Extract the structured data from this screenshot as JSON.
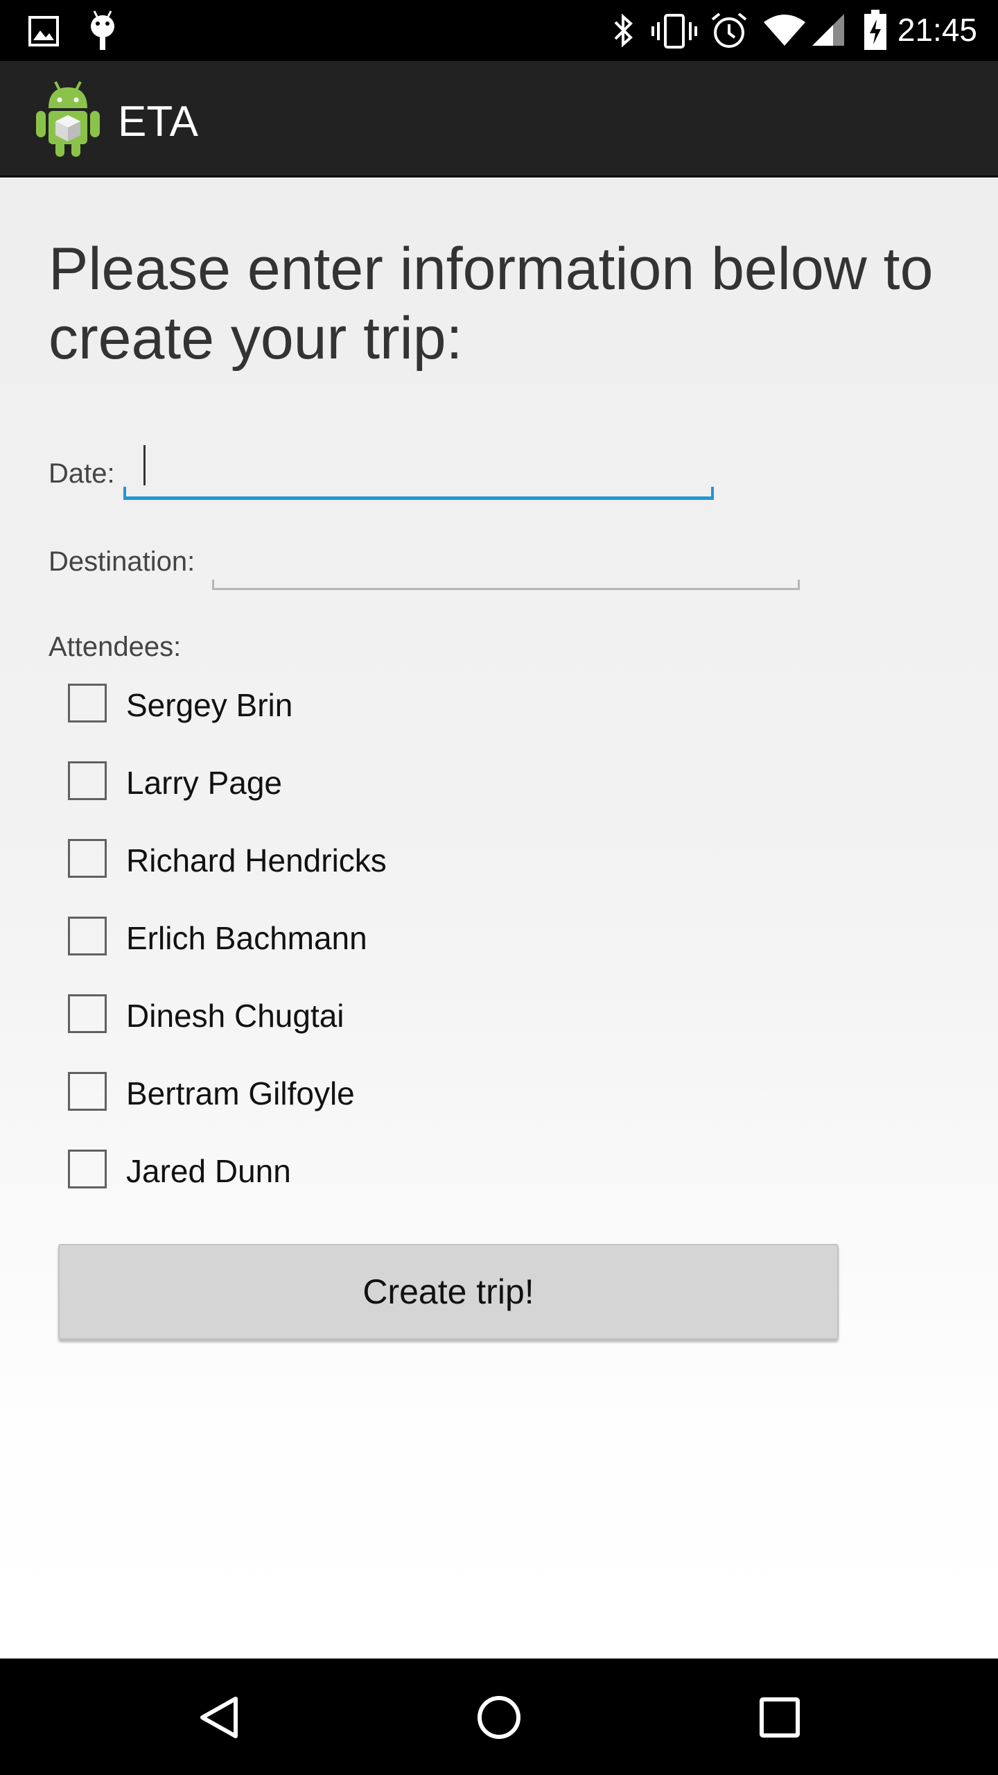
{
  "status_bar": {
    "time": "21:45",
    "left_icons": [
      "image-icon",
      "android-debug-icon"
    ],
    "right_icons": [
      "bluetooth-icon",
      "vibrate-icon",
      "alarm-icon",
      "wifi-icon",
      "cell-signal-icon",
      "battery-charging-icon"
    ]
  },
  "action_bar": {
    "title": "ETA",
    "logo_icon": "android-app-icon"
  },
  "form": {
    "heading": "Please enter information below to create your trip:",
    "date_label": "Date:",
    "date_value": "",
    "destination_label": "Destination:",
    "destination_value": "",
    "attendees_label": "Attendees:",
    "attendees": [
      {
        "name": "Sergey Brin",
        "checked": false
      },
      {
        "name": "Larry Page",
        "checked": false
      },
      {
        "name": "Richard Hendricks",
        "checked": false
      },
      {
        "name": "Erlich Bachmann",
        "checked": false
      },
      {
        "name": "Dinesh Chugtai",
        "checked": false
      },
      {
        "name": "Bertram Gilfoyle",
        "checked": false
      },
      {
        "name": "Jared Dunn",
        "checked": false
      }
    ],
    "submit_label": "Create trip!"
  },
  "nav_bar": {
    "buttons": [
      "back-icon",
      "home-icon",
      "recents-icon"
    ]
  },
  "colors": {
    "accent": "#2196d3",
    "action_bar": "#222222",
    "button": "#d5d5d5"
  }
}
